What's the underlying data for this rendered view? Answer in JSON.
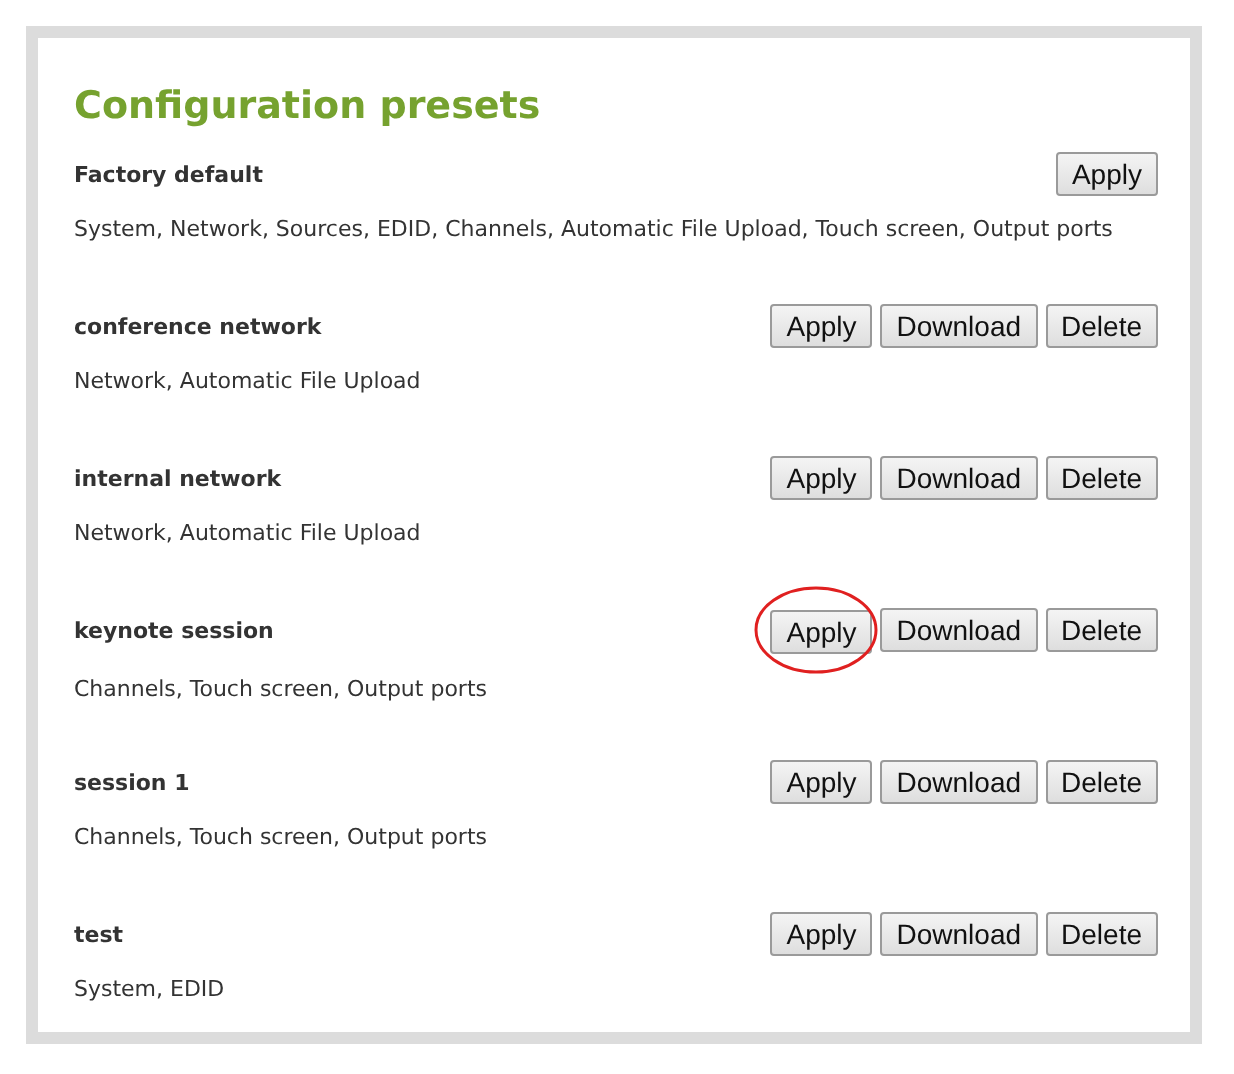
{
  "title": "Configuration presets",
  "presets": [
    {
      "name": "Factory default",
      "items": "System, Network, Sources, EDID, Channels, Automatic File Upload, Touch screen, Output ports",
      "buttons": [
        "Apply"
      ],
      "circled": false
    },
    {
      "name": "conference network",
      "items": "Network, Automatic File Upload",
      "buttons": [
        "Apply",
        "Download",
        "Delete"
      ],
      "circled": false
    },
    {
      "name": "internal network",
      "items": "Network, Automatic File Upload",
      "buttons": [
        "Apply",
        "Download",
        "Delete"
      ],
      "circled": false
    },
    {
      "name": "keynote session",
      "items": "Channels, Touch screen, Output ports",
      "buttons": [
        "Apply",
        "Download",
        "Delete"
      ],
      "circled": true
    },
    {
      "name": "session 1",
      "items": "Channels, Touch screen, Output ports",
      "buttons": [
        "Apply",
        "Download",
        "Delete"
      ],
      "circled": false
    },
    {
      "name": "test",
      "items": "System, EDID",
      "buttons": [
        "Apply",
        "Download",
        "Delete"
      ],
      "circled": false
    }
  ]
}
